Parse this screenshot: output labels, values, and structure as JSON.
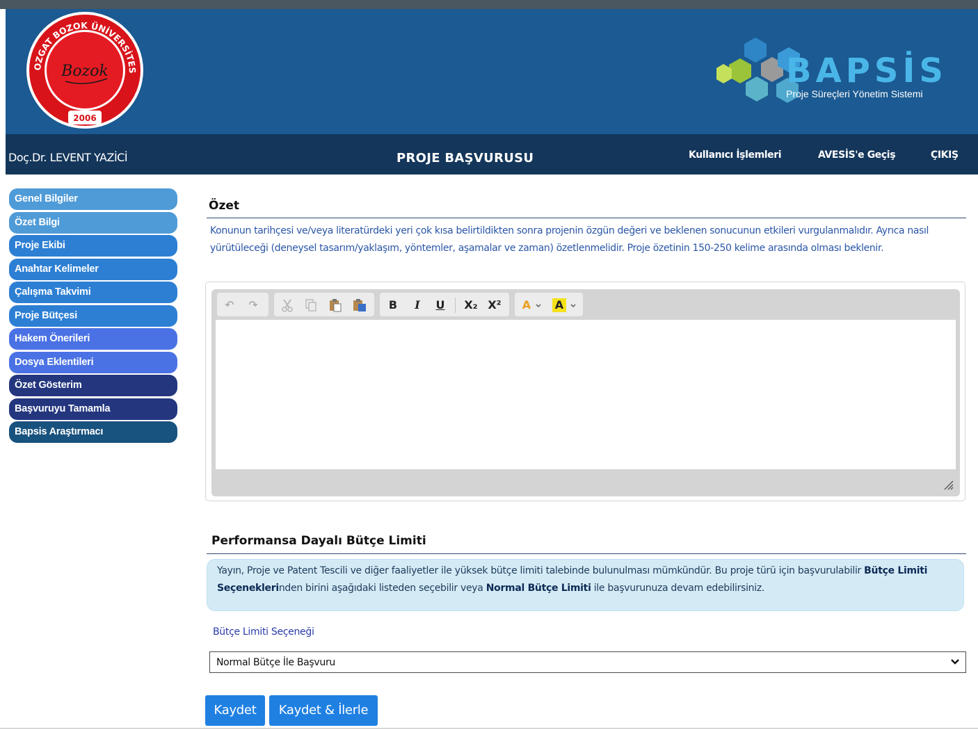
{
  "header": {
    "seal": {
      "arc_text": "YOZGAT BOZOK ÜNİVERSİTESİ",
      "signature": "Bozok",
      "year": "2006"
    },
    "brand": {
      "name": "BAPSİS",
      "subtitle": "Proje Süreçleri Yönetim Sistemi"
    }
  },
  "nav": {
    "user": "Doç.Dr. LEVENT YAZİCİ",
    "title": "PROJE BAŞVURUSU",
    "links": [
      "Kullanıcı İşlemleri",
      "AVESİS'e Geçiş",
      "ÇIKIŞ"
    ]
  },
  "sidebar": {
    "items": [
      {
        "label": "Genel Bilgiler"
      },
      {
        "label": "Özet Bilgi"
      },
      {
        "label": "Proje Ekibi"
      },
      {
        "label": "Anahtar Kelimeler"
      },
      {
        "label": "Çalışma Takvimi"
      },
      {
        "label": "Proje Bütçesi"
      },
      {
        "label": "Hakem Önerileri"
      },
      {
        "label": "Dosya Eklentileri"
      },
      {
        "label": "Özet Gösterim"
      },
      {
        "label": "Başvuruyu Tamamla"
      },
      {
        "label": "Bapsis Araştırmacı"
      }
    ]
  },
  "summary": {
    "title": "Özet",
    "description": "Konunun tarihçesi ve/veya literatürdeki yeri çok kısa belirtildikten sonra projenin özgün değeri ve beklenen sonucunun etkileri vurgulanmalıdır. Ayrıca nasıl yürütüleceği (deneysel tasarım/yaklaşım, yöntemler, aşamalar ve zaman) özetlenmelidir. Proje özetinin 150-250 kelime arasında olması beklenir.",
    "editor_value": ""
  },
  "toolbar": {
    "undo": "↶",
    "redo": "↷",
    "bold": "B",
    "italic": "I",
    "underline": "U",
    "subscript": "X₂",
    "superscript": "X²",
    "font_color": "A",
    "bg_color": "A"
  },
  "budget": {
    "title": "Performansa Dayalı Bütçe Limiti",
    "info_part1": "Yayın, Proje ve Patent Tescili ve diğer faaliyetler ile yüksek bütçe limiti talebinde bulunulması mümkündür. Bu proje türü için başvurulabilir ",
    "info_bold1": "Bütçe Limiti Seçenekleri",
    "info_part2": "nden birini aşağıdaki listeden seçebilir veya ",
    "info_bold2": "Normal Bütçe Limiti",
    "info_part3": " ile başvurunuza devam edebilirsiniz.",
    "field_label": "Bütçe Limiti Seçeneği",
    "selected_option": "Normal Bütçe İle Başvuru"
  },
  "buttons": {
    "save": "Kaydet",
    "save_next": "Kaydet & İlerle"
  },
  "colors": {
    "banner": "#1b5a92",
    "navbar": "#14365a",
    "primary_button": "#1f80e2",
    "description_text": "#2a56a6",
    "info_box_bg": "#d4ebf6"
  }
}
